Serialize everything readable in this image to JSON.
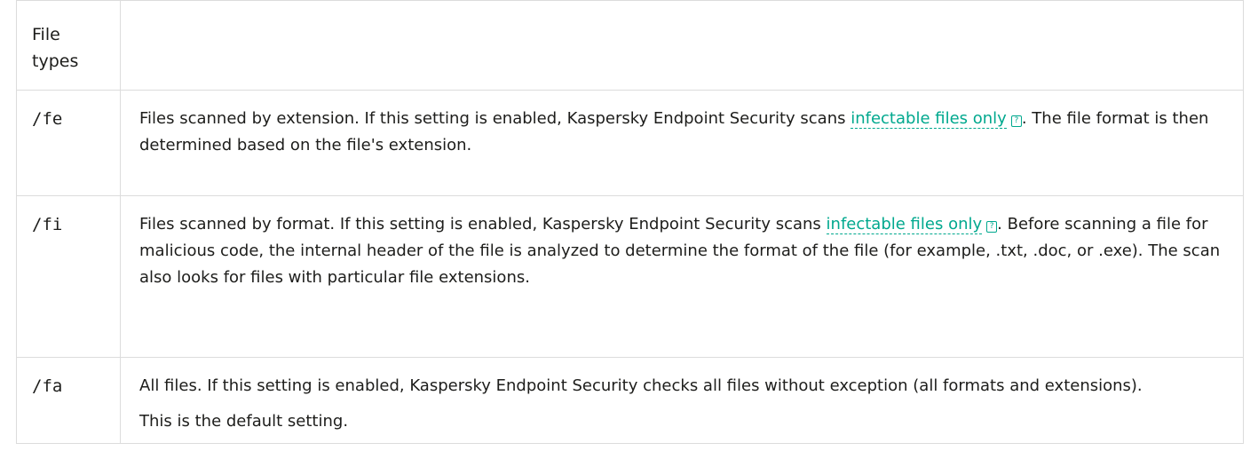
{
  "table": {
    "header": {
      "key_label": "File types",
      "desc_label": ""
    },
    "rows": [
      {
        "key": "/fe",
        "before_link": "Files scanned by extension. If this setting is enabled, Kaspersky Endpoint Security scans ",
        "link_text": "infectable files only",
        "after_link": ". The file format is then determined based on the file's extension."
      },
      {
        "key": "/fi",
        "before_link": "Files scanned by format. If this setting is enabled, Kaspersky Endpoint Security scans ",
        "link_text": "infectable files only",
        "after_link": ". Before scanning a file for malicious code, the internal header of the file is analyzed to determine the format of the file (for example, .txt, .doc, or .exe). The scan also looks for files with particular file extensions."
      },
      {
        "key": "/fa",
        "paragraph_1": "All files. If this setting is enabled, Kaspersky Endpoint Security checks all files without exception (all formats and extensions).",
        "paragraph_2": "This is the default setting."
      }
    ]
  },
  "icons": {
    "glossary_icon": "?"
  },
  "colors": {
    "link": "#00a88e",
    "border": "#dcdcdc",
    "text": "#1d1d1b"
  }
}
